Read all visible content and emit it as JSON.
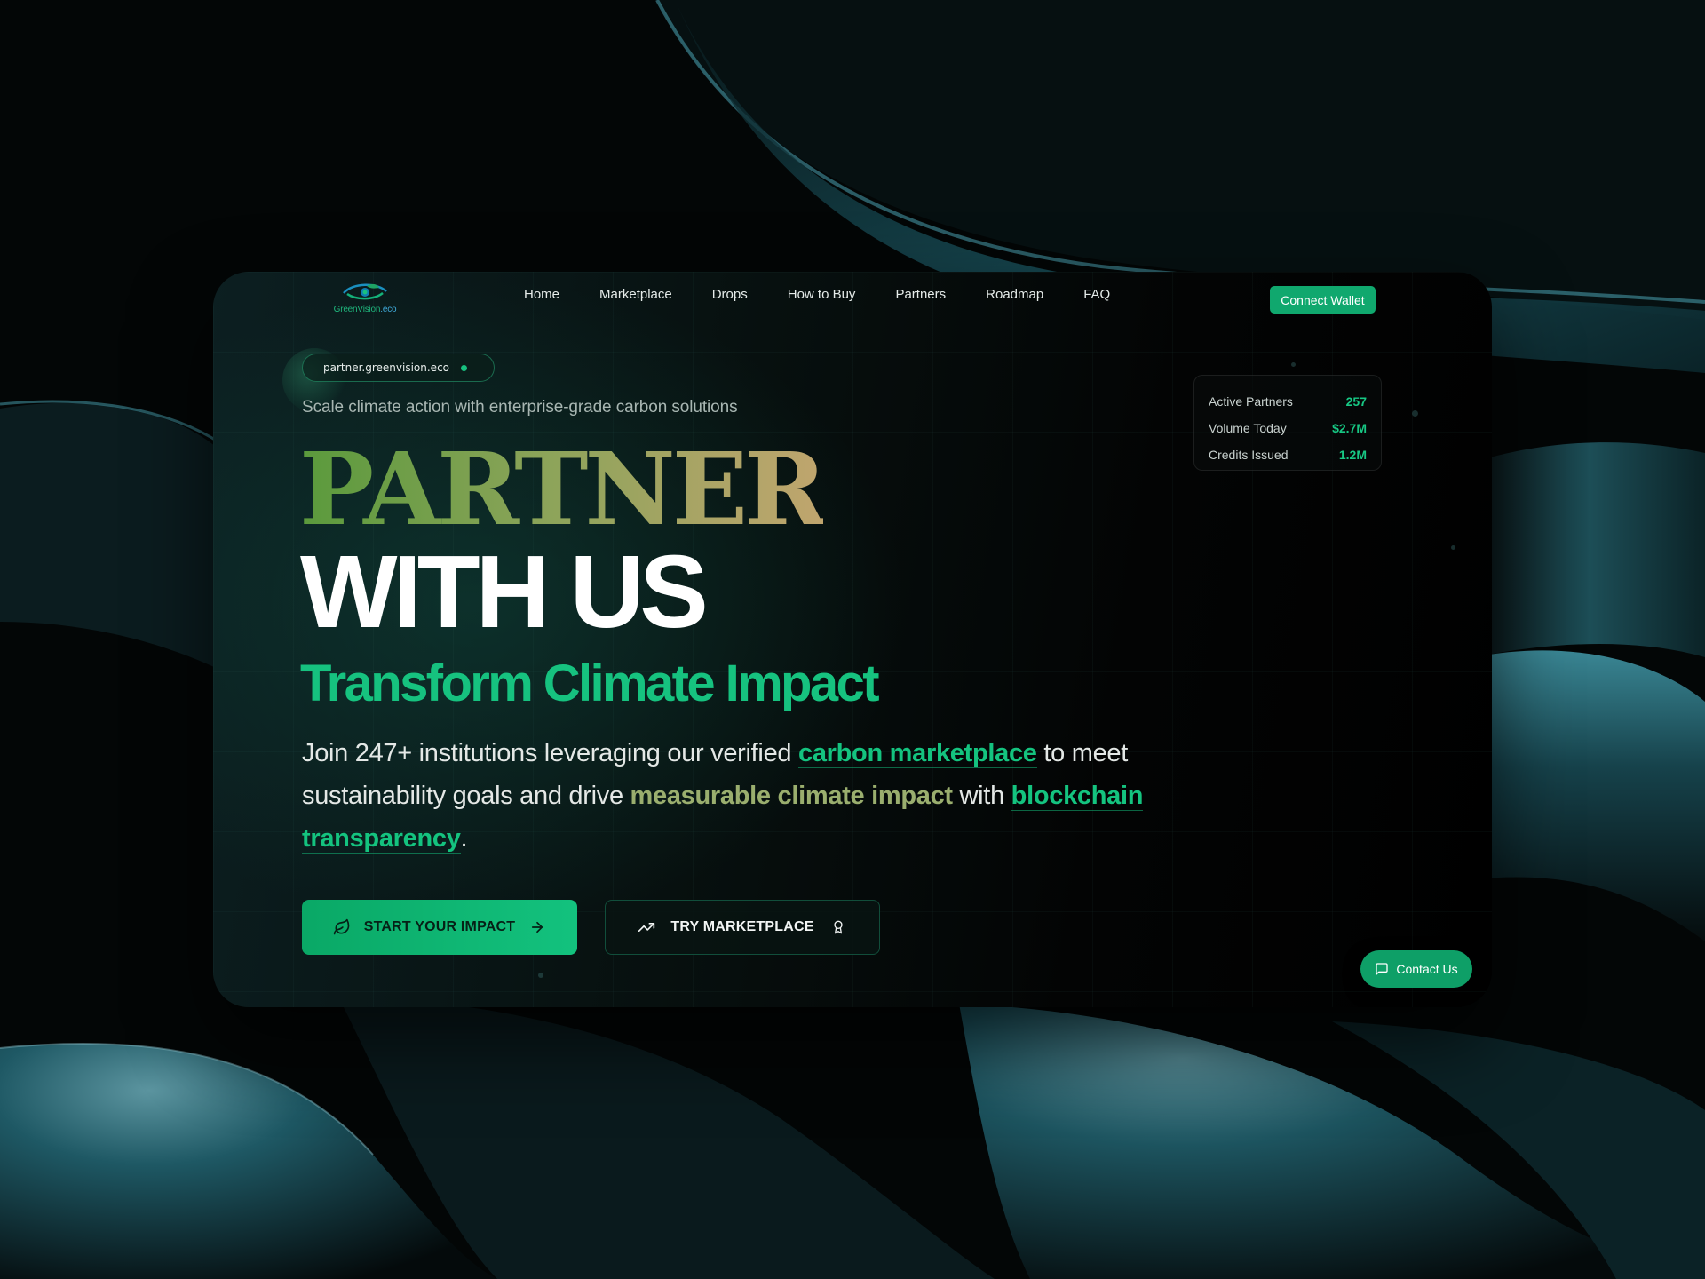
{
  "brand": {
    "logo_text_main": "GreenVision",
    "logo_text_tld": ".eco",
    "accent": "#14c37f",
    "button_green": "#10a86e"
  },
  "nav": {
    "items": [
      {
        "label": "Home"
      },
      {
        "label": "Marketplace"
      },
      {
        "label": "Drops"
      },
      {
        "label": "How to Buy"
      },
      {
        "label": "Partners"
      },
      {
        "label": "Roadmap"
      },
      {
        "label": "FAQ"
      }
    ],
    "connect_label": "Connect Wallet"
  },
  "hero": {
    "url_pill": "partner.greenvision.eco",
    "subline": "Scale climate action with enterprise-grade carbon solutions",
    "title_line1": "PARTNER",
    "title_line2": "WITH US",
    "title_line3": "Transform Climate Impact",
    "desc": {
      "part1": "Join 247+ institutions leveraging our verified ",
      "hl1": "carbon marketplace",
      "part2": " to meet sustainability goals and drive ",
      "hl2": "measurable climate impact",
      "part3": " with ",
      "hl3": "blockchain transparency",
      "part4": "."
    },
    "primary_button": "START YOUR IMPACT",
    "secondary_button": "TRY MARKETPLACE"
  },
  "stats": [
    {
      "label": "Active Partners",
      "value": "257"
    },
    {
      "label": "Volume Today",
      "value": "$2.7M"
    },
    {
      "label": "Credits Issued",
      "value": "1.2M"
    }
  ],
  "contact": {
    "label": "Contact Us"
  },
  "icons": {
    "logo": "eye-leaf-logo",
    "primary_left": "leaf-icon",
    "primary_right": "arrow-right-icon",
    "secondary_left": "trending-up-icon",
    "secondary_right": "award-icon",
    "contact": "message-square-icon"
  }
}
